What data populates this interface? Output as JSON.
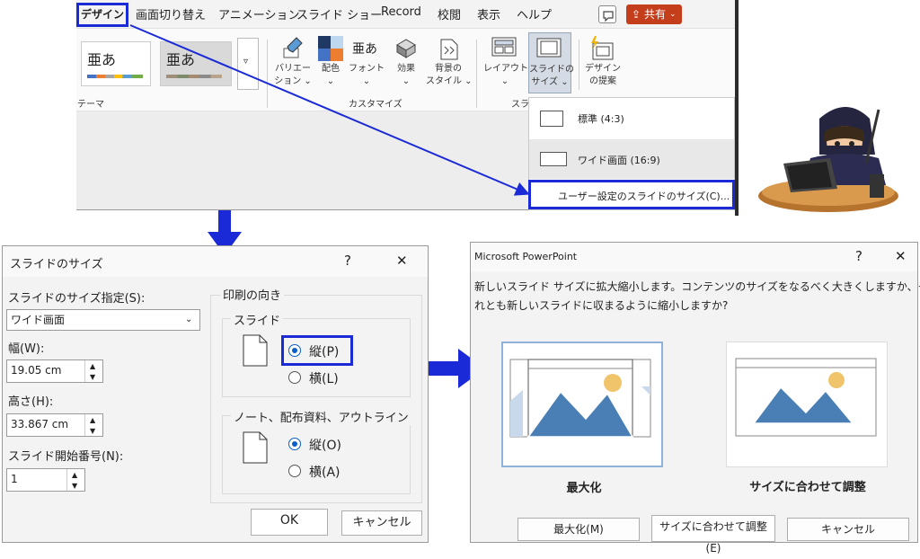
{
  "ribbon": {
    "tabs": [
      "デザイン",
      "画面切り替え",
      "アニメーション",
      "スライド ショー",
      "Record",
      "校閲",
      "表示",
      "ヘルプ"
    ],
    "share_label": "共有",
    "theme_sample": "亜あ",
    "buttons": {
      "variation": [
        "バリエー",
        "ション ⌄"
      ],
      "color": [
        "配色",
        "⌄"
      ],
      "font": [
        "フォント",
        "⌄"
      ],
      "effect": [
        "効果",
        "⌄"
      ],
      "background": [
        "背景の",
        "スタイル ⌄"
      ],
      "layout": [
        "レイアウト",
        "⌄"
      ],
      "slide_size": [
        "スライドの",
        "サイズ ⌄"
      ],
      "design_ideas": [
        "デザイン",
        "の提案"
      ]
    },
    "groups": {
      "themes": "テーマ",
      "customize": "カスタマイズ",
      "slides_partial": "スラ"
    },
    "font_glyph": "亜あ"
  },
  "size_menu": {
    "items": [
      "標準 (4:3)",
      "ワイド画面 (16:9)",
      "ユーザー設定のスライドのサイズ(C)..."
    ]
  },
  "size_dialog": {
    "title": "スライドのサイズ",
    "help": "?",
    "close": "✕",
    "size_label": "スライドのサイズ指定(S):",
    "size_value": "ワイド画面",
    "width_label": "幅(W):",
    "width_value": "19.05 cm",
    "height_label": "高さ(H):",
    "height_value": "33.867 cm",
    "start_label": "スライド開始番号(N):",
    "start_value": "1",
    "orientation_title": "印刷の向き",
    "slide_group": "スライド",
    "portrait_p": "縦(P)",
    "landscape_l": "横(L)",
    "notes_group": "ノート、配布資料、アウトライン",
    "portrait_o": "縦(O)",
    "landscape_a": "横(A)",
    "ok": "OK",
    "cancel": "キャンセル"
  },
  "scale_dialog": {
    "title": "Microsoft PowerPoint",
    "help": "?",
    "close": "✕",
    "message_line1": "新しいスライド サイズに拡大縮小します。コンテンツのサイズをなるべく大きくしますか、そ",
    "message_line2": "れとも新しいスライドに収まるように縮小しますか?",
    "option_max": "最大化",
    "option_fit": "サイズに合わせて調整",
    "btn_max": "最大化(M)",
    "btn_fit": "サイズに合わせて調整(E)",
    "btn_cancel": "キャンセル"
  },
  "colors": {
    "accent": "#1a2ad6",
    "share": "#c43e1c",
    "radio": "#0a5fc4",
    "mountain": "#4a7fb5",
    "sun": "#f0c46a"
  }
}
